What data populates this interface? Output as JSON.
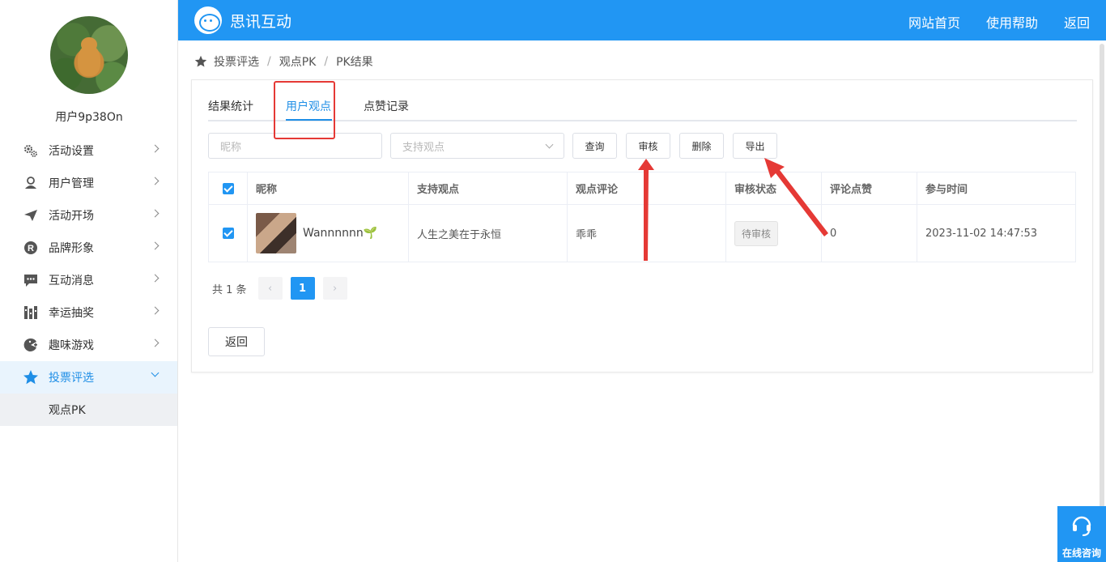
{
  "user": {
    "name": "用户9p38On"
  },
  "sidebar": {
    "items": [
      {
        "label": "活动设置",
        "icon": "gear-icon"
      },
      {
        "label": "用户管理",
        "icon": "user-icon"
      },
      {
        "label": "活动开场",
        "icon": "paper-plane-icon"
      },
      {
        "label": "品牌形象",
        "icon": "registered-icon"
      },
      {
        "label": "互动消息",
        "icon": "chat-icon"
      },
      {
        "label": "幸运抽奖",
        "icon": "lottery-icon"
      },
      {
        "label": "趣味游戏",
        "icon": "game-icon"
      },
      {
        "label": "投票评选",
        "icon": "star-icon",
        "active": true
      }
    ],
    "sub_items": [
      {
        "label": "观点PK"
      }
    ]
  },
  "header": {
    "brand": "思讯互动",
    "nav": [
      "网站首页",
      "使用帮助",
      "返回"
    ],
    "color": "#2196f3"
  },
  "breadcrumb": [
    "投票评选",
    "观点PK",
    "PK结果"
  ],
  "tabs": [
    {
      "label": "结果统计"
    },
    {
      "label": "用户观点",
      "active": true
    },
    {
      "label": "点赞记录"
    }
  ],
  "filters": {
    "nickname_placeholder": "昵称",
    "viewpoint_placeholder": "支持观点"
  },
  "toolbar": {
    "query_label": "查询",
    "review_label": "审核",
    "delete_label": "删除",
    "export_label": "导出"
  },
  "table": {
    "columns": [
      "昵称",
      "支持观点",
      "观点评论",
      "审核状态",
      "评论点赞",
      "参与时间"
    ],
    "rows": [
      {
        "nickname": "Wannnnnn🌱",
        "viewpoint": "人生之美在于永恒",
        "comment": "乖乖",
        "status": "待审核",
        "likes": "0",
        "time": "2023-11-02 14:47:53"
      }
    ]
  },
  "pagination": {
    "total_text": "共 1 条",
    "prev": "‹",
    "page": "1",
    "next": "›"
  },
  "back_button": "返回",
  "consult": {
    "label": "在线咨询"
  },
  "annotation_color": "#e53935"
}
